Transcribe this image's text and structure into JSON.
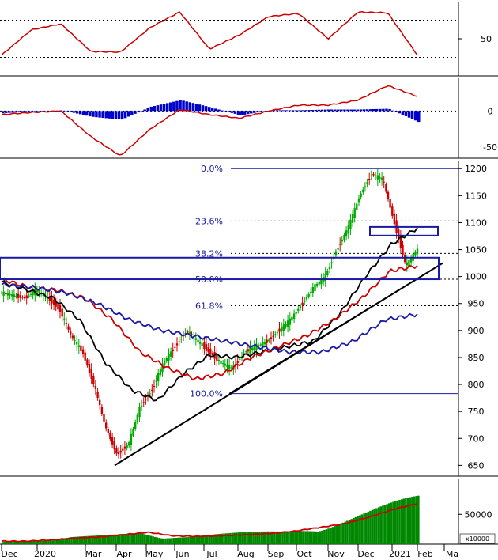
{
  "chart_data": [
    {
      "type": "line",
      "panel": "RSI",
      "y_ticks": [
        "50"
      ],
      "ylim": [
        0,
        100
      ],
      "reference_levels": [
        75,
        25
      ],
      "series": [
        {
          "color": "#cc0000",
          "x": [
            "Dec",
            "Jan",
            "Feb",
            "Mar",
            "Apr",
            "May",
            "Jun",
            "Jul",
            "Aug",
            "Sep",
            "Oct",
            "Nov",
            "Dec",
            "Jan",
            "Feb"
          ],
          "values": [
            28,
            62,
            70,
            33,
            32,
            65,
            86,
            36,
            55,
            80,
            84,
            50,
            86,
            85,
            28
          ]
        }
      ]
    },
    {
      "type": "line",
      "panel": "MACD",
      "y_ticks": [
        "0",
        "-50"
      ],
      "ylim": [
        -65,
        45
      ],
      "series": [
        {
          "color": "#cc0000",
          "values": [
            -5,
            -2,
            0,
            -35,
            -62,
            -25,
            2,
            -5,
            -10,
            0,
            8,
            8,
            15,
            35,
            20
          ]
        },
        {
          "color": "#0000cc",
          "type": "bar",
          "values": [
            -3,
            -1,
            1,
            -8,
            -12,
            6,
            15,
            5,
            -6,
            1,
            1,
            2,
            2,
            3,
            -15
          ]
        }
      ]
    },
    {
      "type": "candlestick",
      "panel": "price",
      "y_ticks": [
        "1200",
        "1150",
        "1100",
        "1050",
        "1000",
        "950",
        "900",
        "850",
        "800",
        "750",
        "700",
        "650"
      ],
      "ylim": [
        630,
        1215
      ],
      "x_labels": [
        "Dec",
        "2020",
        "Mar",
        "Apr",
        "May",
        "Jun",
        "Jul",
        "Aug",
        "Sep",
        "Oct",
        "Nov",
        "Dec",
        "2021",
        "Feb",
        "Ma"
      ],
      "close": [
        970,
        965,
        960,
        975,
        960,
        940,
        890,
        860,
        800,
        720,
        670,
        690,
        760,
        790,
        840,
        870,
        900,
        880,
        860,
        840,
        830,
        860,
        870,
        880,
        900,
        920,
        950,
        980,
        1000,
        1050,
        1090,
        1150,
        1190,
        1180,
        1100,
        1020,
        1050
      ],
      "fibonacci": [
        {
          "label": "0.0%",
          "value": 1200
        },
        {
          "label": "23.6%",
          "value": 1103
        },
        {
          "label": "38.2%",
          "value": 1043
        },
        {
          "label": "50.0%",
          "value": 995
        },
        {
          "label": "61.8%",
          "value": 946
        },
        {
          "label": "100.0%",
          "value": 783
        }
      ],
      "moving_averages": [
        {
          "color": "#000000",
          "values": [
            990,
            975,
            960,
            920,
            840,
            790,
            770,
            820,
            855,
            850,
            860,
            870,
            880,
            930,
            1000,
            1060,
            1090
          ]
        },
        {
          "color": "#cc0000",
          "values": [
            995,
            980,
            975,
            960,
            920,
            860,
            830,
            810,
            820,
            850,
            870,
            890,
            920,
            960,
            1010,
            1020
          ]
        },
        {
          "color": "#1a1aa6",
          "values": [
            985,
            980,
            970,
            950,
            920,
            900,
            890,
            880,
            870,
            860,
            860,
            880,
            920,
            930
          ]
        }
      ]
    },
    {
      "type": "bar",
      "panel": "volume",
      "y_ticks": [
        "50000"
      ],
      "unit": "x10000",
      "ylim": [
        0,
        110000
      ],
      "series": [
        {
          "color": "#008800",
          "type": "bar",
          "values": [
            5000,
            6000,
            5000,
            10000,
            12000,
            15000,
            20000,
            12000,
            12000,
            14000,
            16000,
            18000,
            20000,
            25000,
            30000,
            40000,
            50000,
            60000,
            70000
          ]
        },
        {
          "color": "#cc0000",
          "values": [
            5000,
            5000,
            7000,
            10000,
            12000,
            16000,
            20000,
            14000,
            13000,
            14000,
            16000,
            18000,
            22000,
            28000,
            34000,
            45000,
            58000,
            68000
          ]
        }
      ]
    }
  ]
}
